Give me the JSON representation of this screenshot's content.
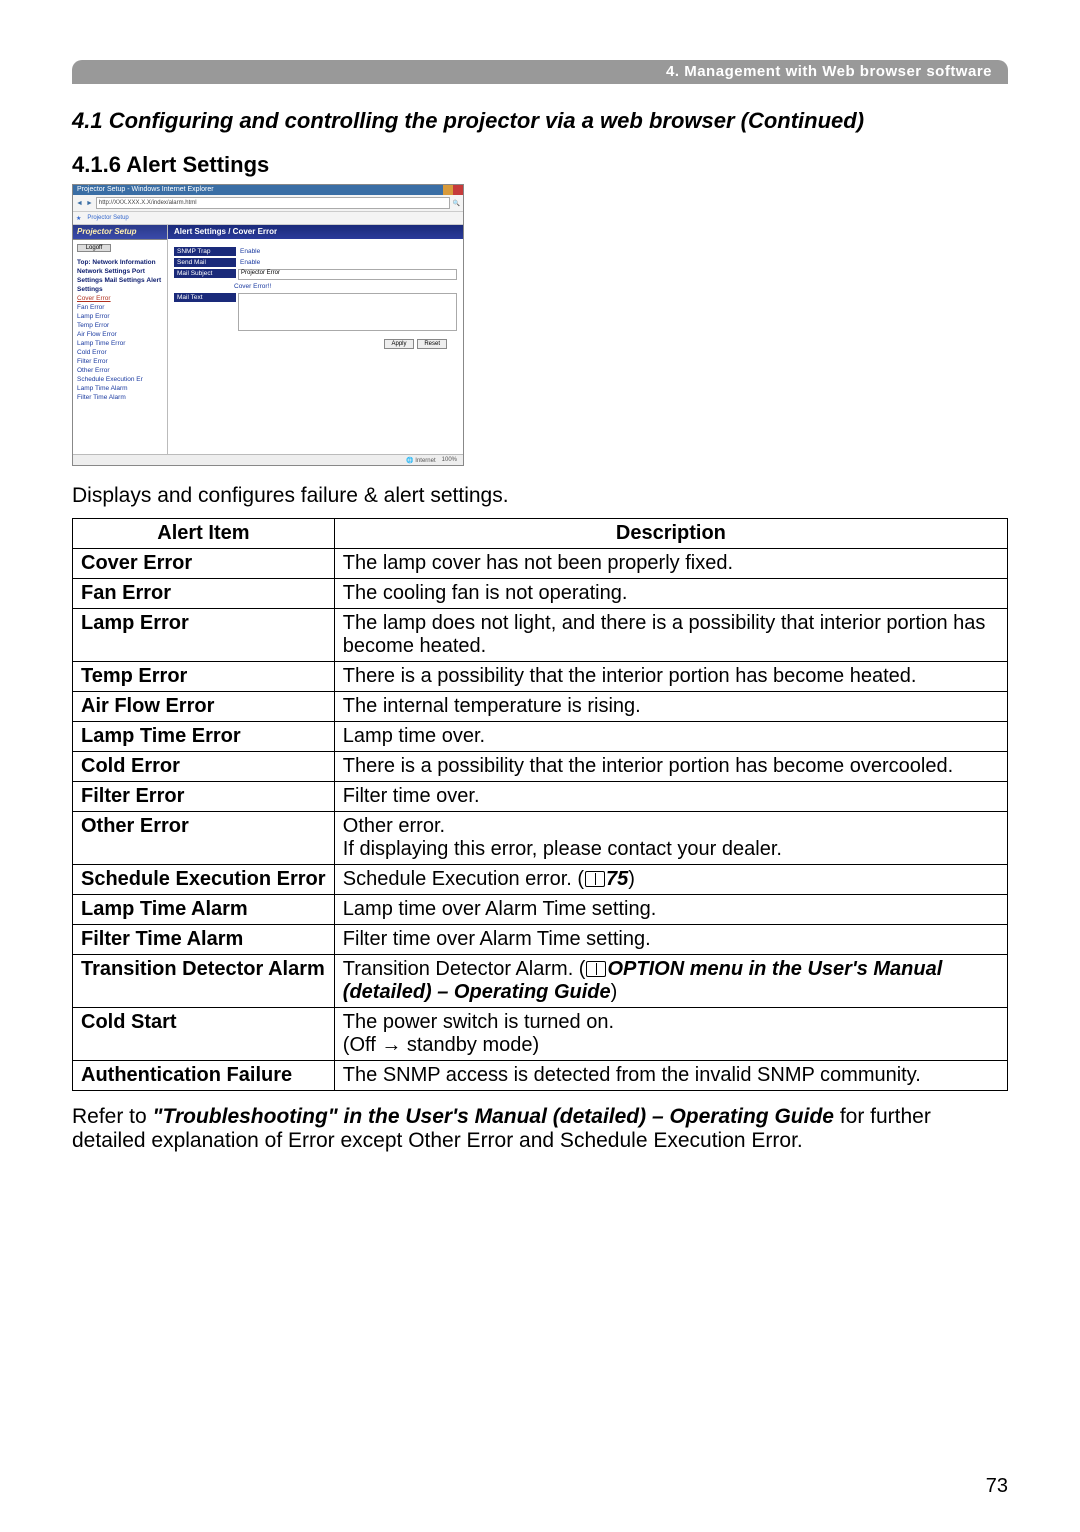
{
  "header": "4. Management with Web browser software",
  "section_title": "4.1 Configuring and controlling the projector via a web browser (Continued)",
  "subsection": "4.1.6 Alert Settings",
  "screenshot": {
    "window_title": "Projector Setup - Windows Internet Explorer",
    "url": "http://XXX.XXX.X.X/index/alarm.html",
    "tab_label": "Projector Setup",
    "side_header": "Projector Setup",
    "logoff": "Logoff",
    "side_top": [
      "Top:",
      "Network",
      "Information"
    ],
    "side_groups": [
      {
        "title": "Network Settings"
      },
      {
        "title": "Port Settings"
      },
      {
        "title": "Mail Settings"
      },
      {
        "title": "Alert Settings",
        "items": [
          {
            "label": "Cover Error",
            "selected": true
          },
          {
            "label": "Fan Error"
          },
          {
            "label": "Lamp Error"
          },
          {
            "label": "Temp Error"
          },
          {
            "label": "Air Flow Error"
          },
          {
            "label": "Lamp Time Error"
          },
          {
            "label": "Cold Error"
          },
          {
            "label": "Filter Error"
          },
          {
            "label": "Other Error"
          },
          {
            "label": "Schedule Execution Er"
          },
          {
            "label": "Lamp Time Alarm"
          },
          {
            "label": "Filter Time Alarm"
          }
        ]
      }
    ],
    "main_header": "Alert Settings / Cover Error",
    "form": {
      "snmp_trap_label": "SNMP Trap",
      "snmp_trap_val": "Enable",
      "send_mail_label": "Send Mail",
      "send_mail_val": "Enable",
      "mail_subject_label": "Mail Subject",
      "mail_subject_val": "Projector Error",
      "cover_label": "Cover Error!!",
      "mail_text_label": "Mail Text"
    },
    "apply": "Apply",
    "reset": "Reset",
    "status_internet": "Internet",
    "status_zoom": "100%"
  },
  "caption": "Displays and configures failure & alert settings.",
  "table": {
    "hdr_item": "Alert Item",
    "hdr_desc": "Description",
    "rows": [
      {
        "item": "Cover Error",
        "desc": "The lamp cover has not been properly fixed."
      },
      {
        "item": "Fan Error",
        "desc": "The cooling fan is not operating."
      },
      {
        "item": "Lamp Error",
        "desc": "The lamp does not light, and there is a possibility that interior portion has become heated."
      },
      {
        "item": "Temp Error",
        "desc": "There is a possibility that the interior portion has become heated."
      },
      {
        "item": "Air Flow Error",
        "desc": "The internal temperature is rising."
      },
      {
        "item": "Lamp Time Error",
        "desc": "Lamp time over."
      },
      {
        "item": "Cold Error",
        "desc": "There is a possibility that the interior portion has become overcooled."
      },
      {
        "item": "Filter Error",
        "desc": "Filter time over."
      },
      {
        "item": "Other Error",
        "desc": "Other error.\nIf displaying this error, please contact your dealer."
      },
      {
        "item": "Schedule Execution Error",
        "desc_pre": "Schedule Execution error. (",
        "desc_ref": "75",
        "desc_post": ")"
      },
      {
        "item": "Lamp Time Alarm",
        "desc": "Lamp time over Alarm Time setting."
      },
      {
        "item": "Filter Time Alarm",
        "desc": "Filter time over Alarm Time setting."
      },
      {
        "item": "Transition Detector Alarm",
        "desc_pre": "Transition Detector Alarm. (",
        "desc_ital": "OPTION menu in the User's Manual (detailed) – Operating Guide",
        "desc_post": ")"
      },
      {
        "item": "Cold Start",
        "desc": "The power switch is turned on.\n(Off → standby mode)"
      },
      {
        "item": "Authentication Failure",
        "desc": "The SNMP access is detected from the invalid SNMP community."
      }
    ]
  },
  "footnote": {
    "pre": "Refer to ",
    "ital": "\"Troubleshooting\" in the User's Manual (detailed) – Operating Guide",
    "post": " for further detailed explanation of Error except Other Error and Schedule Execution Error."
  },
  "page_number": "73"
}
